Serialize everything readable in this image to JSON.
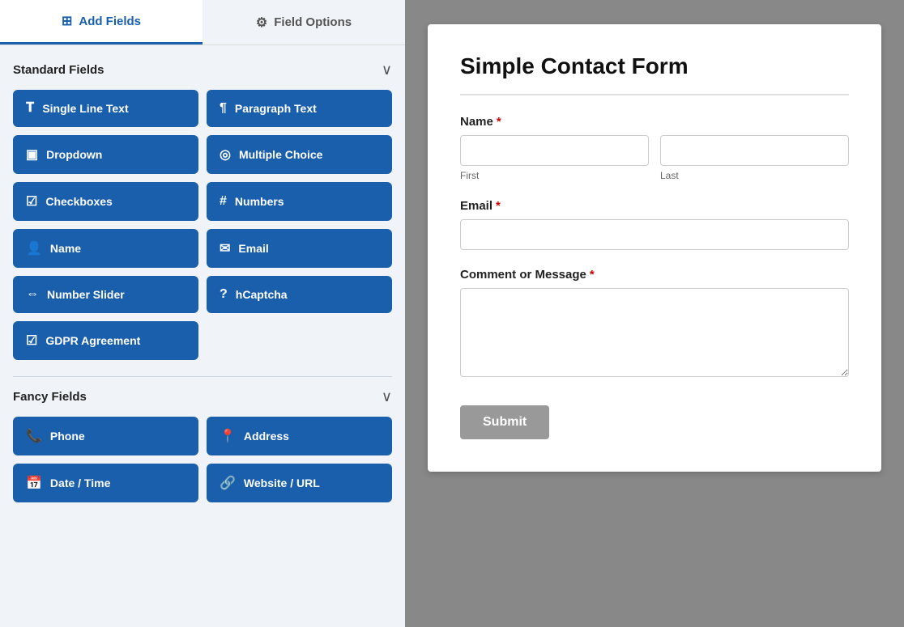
{
  "tabs": {
    "add_fields": {
      "label": "Add Fields",
      "icon": "⊞",
      "active": true
    },
    "field_options": {
      "label": "Field Options",
      "icon": "⚙",
      "active": false
    }
  },
  "standard_fields": {
    "title": "Standard Fields",
    "buttons": [
      {
        "label": "Single Line Text",
        "icon": "T"
      },
      {
        "label": "Paragraph Text",
        "icon": "¶"
      },
      {
        "label": "Dropdown",
        "icon": "▣"
      },
      {
        "label": "Multiple Choice",
        "icon": "◎"
      },
      {
        "label": "Checkboxes",
        "icon": "☑"
      },
      {
        "label": "Numbers",
        "icon": "#"
      },
      {
        "label": "Name",
        "icon": "👤"
      },
      {
        "label": "Email",
        "icon": "✉"
      },
      {
        "label": "Number Slider",
        "icon": "⇔"
      },
      {
        "label": "hCaptcha",
        "icon": "?"
      },
      {
        "label": "GDPR Agreement",
        "icon": "☑"
      }
    ]
  },
  "fancy_fields": {
    "title": "Fancy Fields",
    "buttons": [
      {
        "label": "Phone",
        "icon": "📞"
      },
      {
        "label": "Address",
        "icon": "📍"
      },
      {
        "label": "Date / Time",
        "icon": "📅"
      },
      {
        "label": "Website / URL",
        "icon": "🔗"
      }
    ]
  },
  "form": {
    "title": "Simple Contact Form",
    "fields": [
      {
        "label": "Name",
        "required": true,
        "type": "name",
        "subfields": [
          "First",
          "Last"
        ]
      },
      {
        "label": "Email",
        "required": true,
        "type": "email"
      },
      {
        "label": "Comment or Message",
        "required": true,
        "type": "textarea"
      }
    ],
    "submit_label": "Submit"
  },
  "icons": {
    "grid": "⊞",
    "sliders": "⚙",
    "chevron_down": "∨",
    "single_line": "T",
    "paragraph": "¶",
    "dropdown": "▣",
    "multiple_choice": "◎",
    "checkboxes": "☑",
    "numbers": "#",
    "name": "👤",
    "email": "✉",
    "slider": "⇔",
    "captcha": "?",
    "gdpr": "☑",
    "phone": "📞",
    "address": "📍",
    "datetime": "📅",
    "url": "🔗"
  }
}
